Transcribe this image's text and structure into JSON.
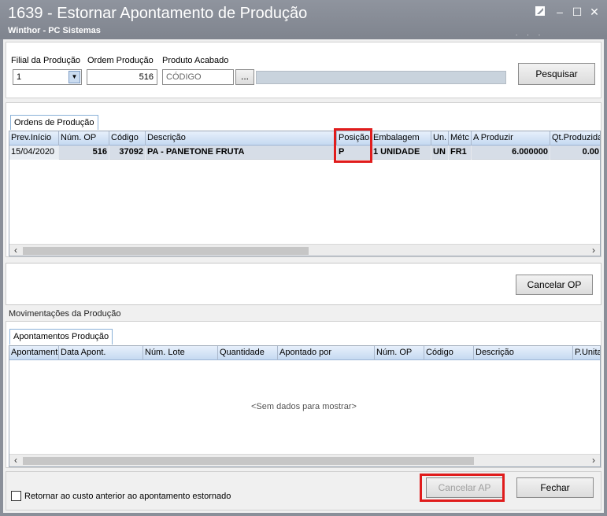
{
  "window": {
    "title": "1639 - Estornar Apontamento de Produção",
    "subtitle": "Winthor - PC Sistemas",
    "controls": {
      "edit_icon": "edit-icon",
      "minimize": "–",
      "maximize": "☐",
      "close": "✕"
    },
    "dots": ". . ."
  },
  "filters": {
    "filial_label": "Filial da Produção",
    "filial_value": "1",
    "ordem_label": "Ordem Produção",
    "ordem_value": "516",
    "produto_label": "Produto Acabado",
    "produto_placeholder": "CÓDIGO",
    "lookup_label": "...",
    "description_value": "",
    "search_label": "Pesquisar"
  },
  "orders": {
    "tab_label": "Ordens de Produção",
    "columns": [
      "Prev.Início",
      "Núm. OP",
      "Código",
      "Descrição",
      "Posição",
      "Embalagem",
      "Un.",
      "Métc",
      "A Produzir",
      "Qt.Produzida"
    ],
    "rows": [
      {
        "prev_inicio": "15/04/2020",
        "num_op": "516",
        "codigo": "37092",
        "descricao": "PA - PANETONE FRUTA",
        "posicao": "P",
        "embalagem": "1 UNIDADE",
        "un": "UN",
        "metodo": "FR1",
        "a_produzir": "6.000000",
        "qt_produzida": "0.00"
      }
    ],
    "cancel_op_label": "Cancelar OP"
  },
  "movements": {
    "group_label": "Movimentações da Produção",
    "tab_label": "Apontamentos Produção",
    "columns": [
      "Apontament",
      "Data Apont.",
      "Núm. Lote",
      "Quantidade",
      "Apontado por",
      "Núm. OP",
      "Código",
      "Descrição",
      "P.Unita"
    ],
    "empty_text": "<Sem dados para mostrar>"
  },
  "footer": {
    "checkbox_label": "Retornar ao custo anterior ao apontamento estornado",
    "checkbox_checked": false,
    "cancel_ap_label": "Cancelar AP",
    "close_label": "Fechar"
  },
  "colors": {
    "highlight": "#e01c1c",
    "titlebar": "#8a8f99"
  }
}
